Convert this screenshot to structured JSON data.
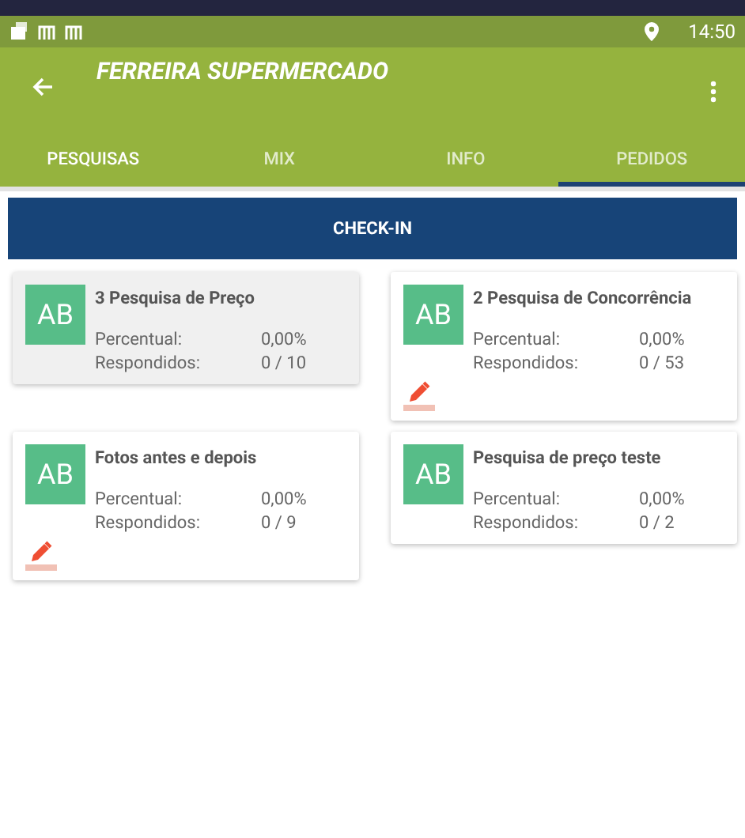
{
  "status_bar": {
    "time": "14:50"
  },
  "app_bar": {
    "title": "FERREIRA SUPERMERCADO"
  },
  "tabs": [
    {
      "label": "PESQUISAS",
      "selected": false,
      "emphasized": true
    },
    {
      "label": "MIX",
      "selected": false,
      "emphasized": false
    },
    {
      "label": "INFO",
      "selected": false,
      "emphasized": false
    },
    {
      "label": "PEDIDOS",
      "selected": true,
      "emphasized": false
    }
  ],
  "checkin_button": "CHECK-IN",
  "surveys": [
    {
      "avatar": "AB",
      "title": "3 Pesquisa de Preço",
      "percent_label": "Percentual:",
      "percent": "0,00%",
      "answered_label": "Respondidos:",
      "answered": "0 / 10",
      "editable": false,
      "selected": true
    },
    {
      "avatar": "AB",
      "title": "2 Pesquisa de Concorrência",
      "percent_label": "Percentual:",
      "percent": "0,00%",
      "answered_label": "Respondidos:",
      "answered": "0 / 53",
      "editable": true,
      "selected": false
    },
    {
      "avatar": "AB",
      "title": "Fotos antes e depois",
      "percent_label": "Percentual:",
      "percent": "0,00%",
      "answered_label": "Respondidos:",
      "answered": "0 / 9",
      "editable": true,
      "selected": false
    },
    {
      "avatar": "AB",
      "title": "Pesquisa de preço teste",
      "percent_label": "Percentual:",
      "percent": "0,00%",
      "answered_label": "Respondidos:",
      "answered": "0 / 2",
      "editable": false,
      "selected": false
    }
  ]
}
